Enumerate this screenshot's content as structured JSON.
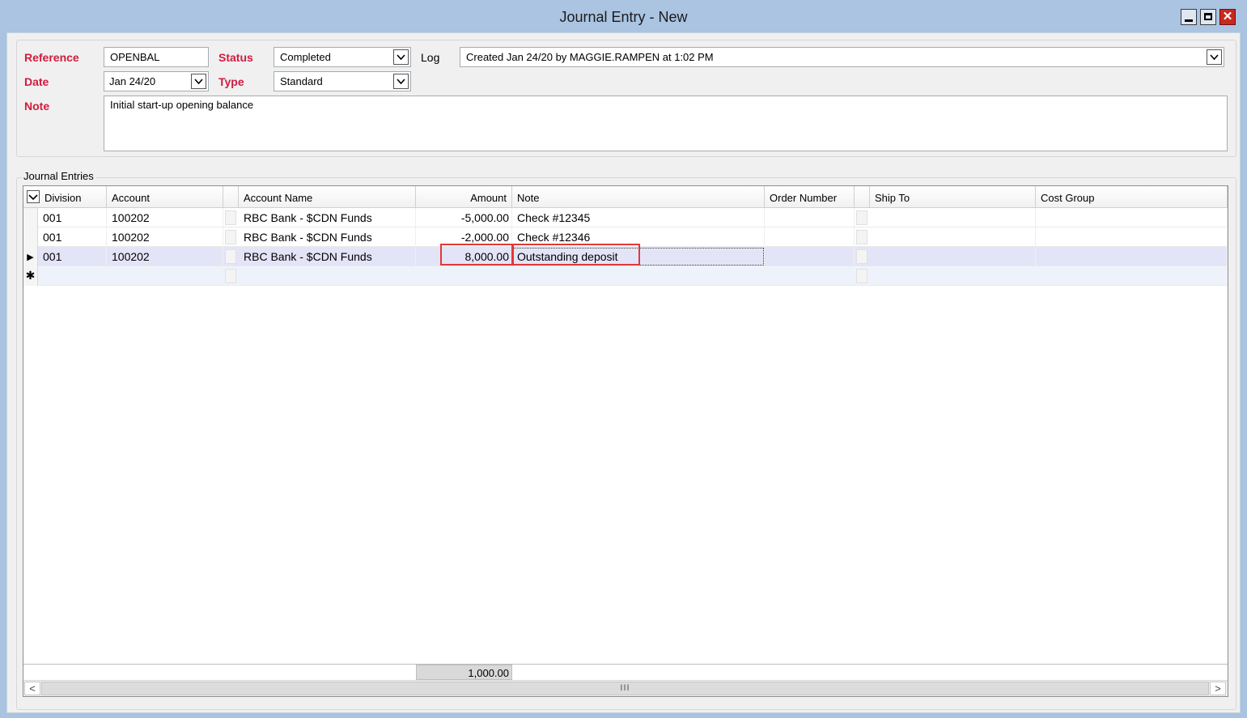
{
  "window": {
    "title": "Journal Entry - New",
    "close_glyph": "✕"
  },
  "form": {
    "reference_label": "Reference",
    "reference_value": "OPENBAL",
    "status_label": "Status",
    "status_value": "Completed",
    "log_label": "Log",
    "log_value": "Created Jan 24/20 by MAGGIE.RAMPEN at 1:02 PM",
    "date_label": "Date",
    "date_value": "Jan 24/20",
    "type_label": "Type",
    "type_value": "Standard",
    "note_label": "Note",
    "note_value": "Initial start-up opening balance"
  },
  "entries": {
    "caption": "Journal Entries",
    "columns": {
      "division": "Division",
      "account": "Account",
      "account_name": "Account Name",
      "amount": "Amount",
      "note": "Note",
      "order_number": "Order Number",
      "ship_to": "Ship To",
      "cost_group": "Cost Group"
    },
    "rows": [
      {
        "division": "001",
        "account": "100202",
        "account_name": "RBC Bank -  $CDN Funds",
        "amount": "-5,000.00",
        "note": "Check #12345"
      },
      {
        "division": "001",
        "account": "100202",
        "account_name": "RBC Bank -  $CDN Funds",
        "amount": "-2,000.00",
        "note": "Check #12346"
      },
      {
        "division": "001",
        "account": "100202",
        "account_name": "RBC Bank -  $CDN Funds",
        "amount": "8,000.00",
        "note": "Outstanding deposit"
      }
    ],
    "current_row_marker": "▶",
    "new_row_marker": "✱",
    "amount_total": "1,000.00"
  },
  "scrollbar": {
    "left_arrow": "<",
    "right_arrow": ">",
    "grip": "III"
  },
  "colors": {
    "label_red": "#d01b3f",
    "highlight_red": "#e23838",
    "selected_row": "#e4e4f8"
  }
}
